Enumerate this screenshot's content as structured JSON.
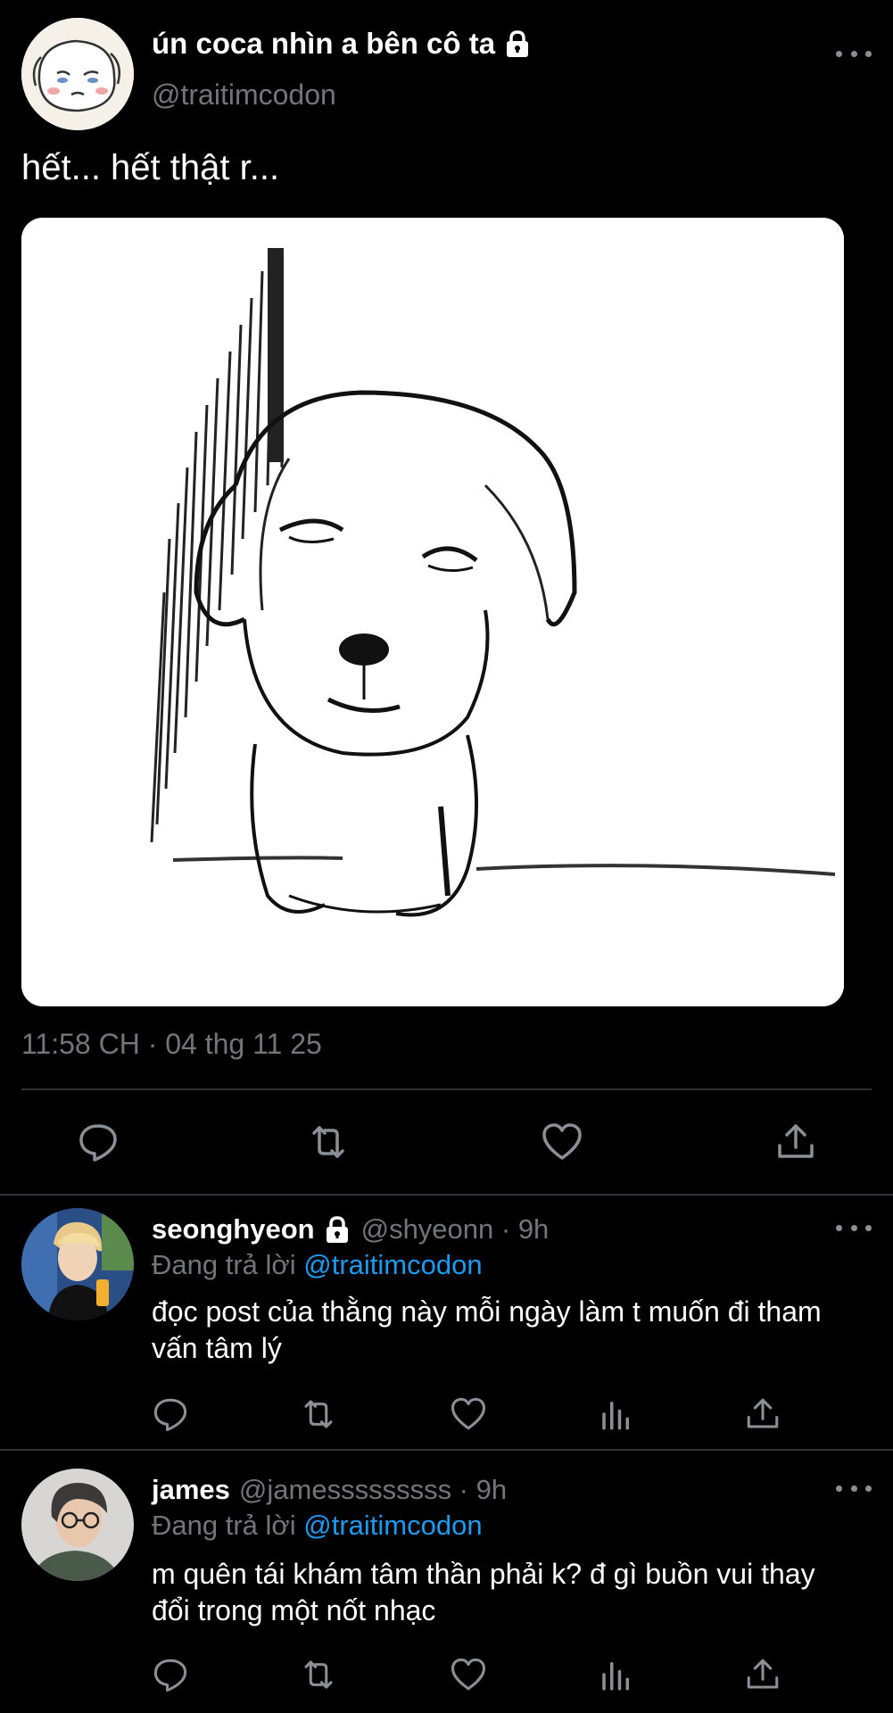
{
  "tweet": {
    "author_name": "ún coca nhìn a bên cô ta",
    "author_handle": "@traitimcodon",
    "text": "hết... hết thật r...",
    "timestamp": "11:58 CH · 04 thg 11 25",
    "avatar_icon": "sad-puppy-avatar",
    "media_icon": "sad-dog-sketch"
  },
  "replies": [
    {
      "name": "seonghyeon",
      "handle": "@shyeonn · 9h",
      "replying_prefix": "Đang trả lời",
      "replying_to": "@traitimcodon",
      "text": "đọc post của thằng này mỗi ngày làm t muốn đi tham vấn tâm lý",
      "locked": true
    },
    {
      "name": "james",
      "handle": "@jamesssssssss · 9h",
      "replying_prefix": "Đang trả lời",
      "replying_to": "@traitimcodon",
      "text": "m quên tái khám tâm thần phải k? đ gì buồn vui thay đổi trong một nốt nhạc",
      "locked": false
    }
  ],
  "colors": {
    "background": "#000000",
    "text": "#ffffff",
    "secondary": "#71767b",
    "link": "#1d9bf0",
    "divider": "#2f3336"
  }
}
